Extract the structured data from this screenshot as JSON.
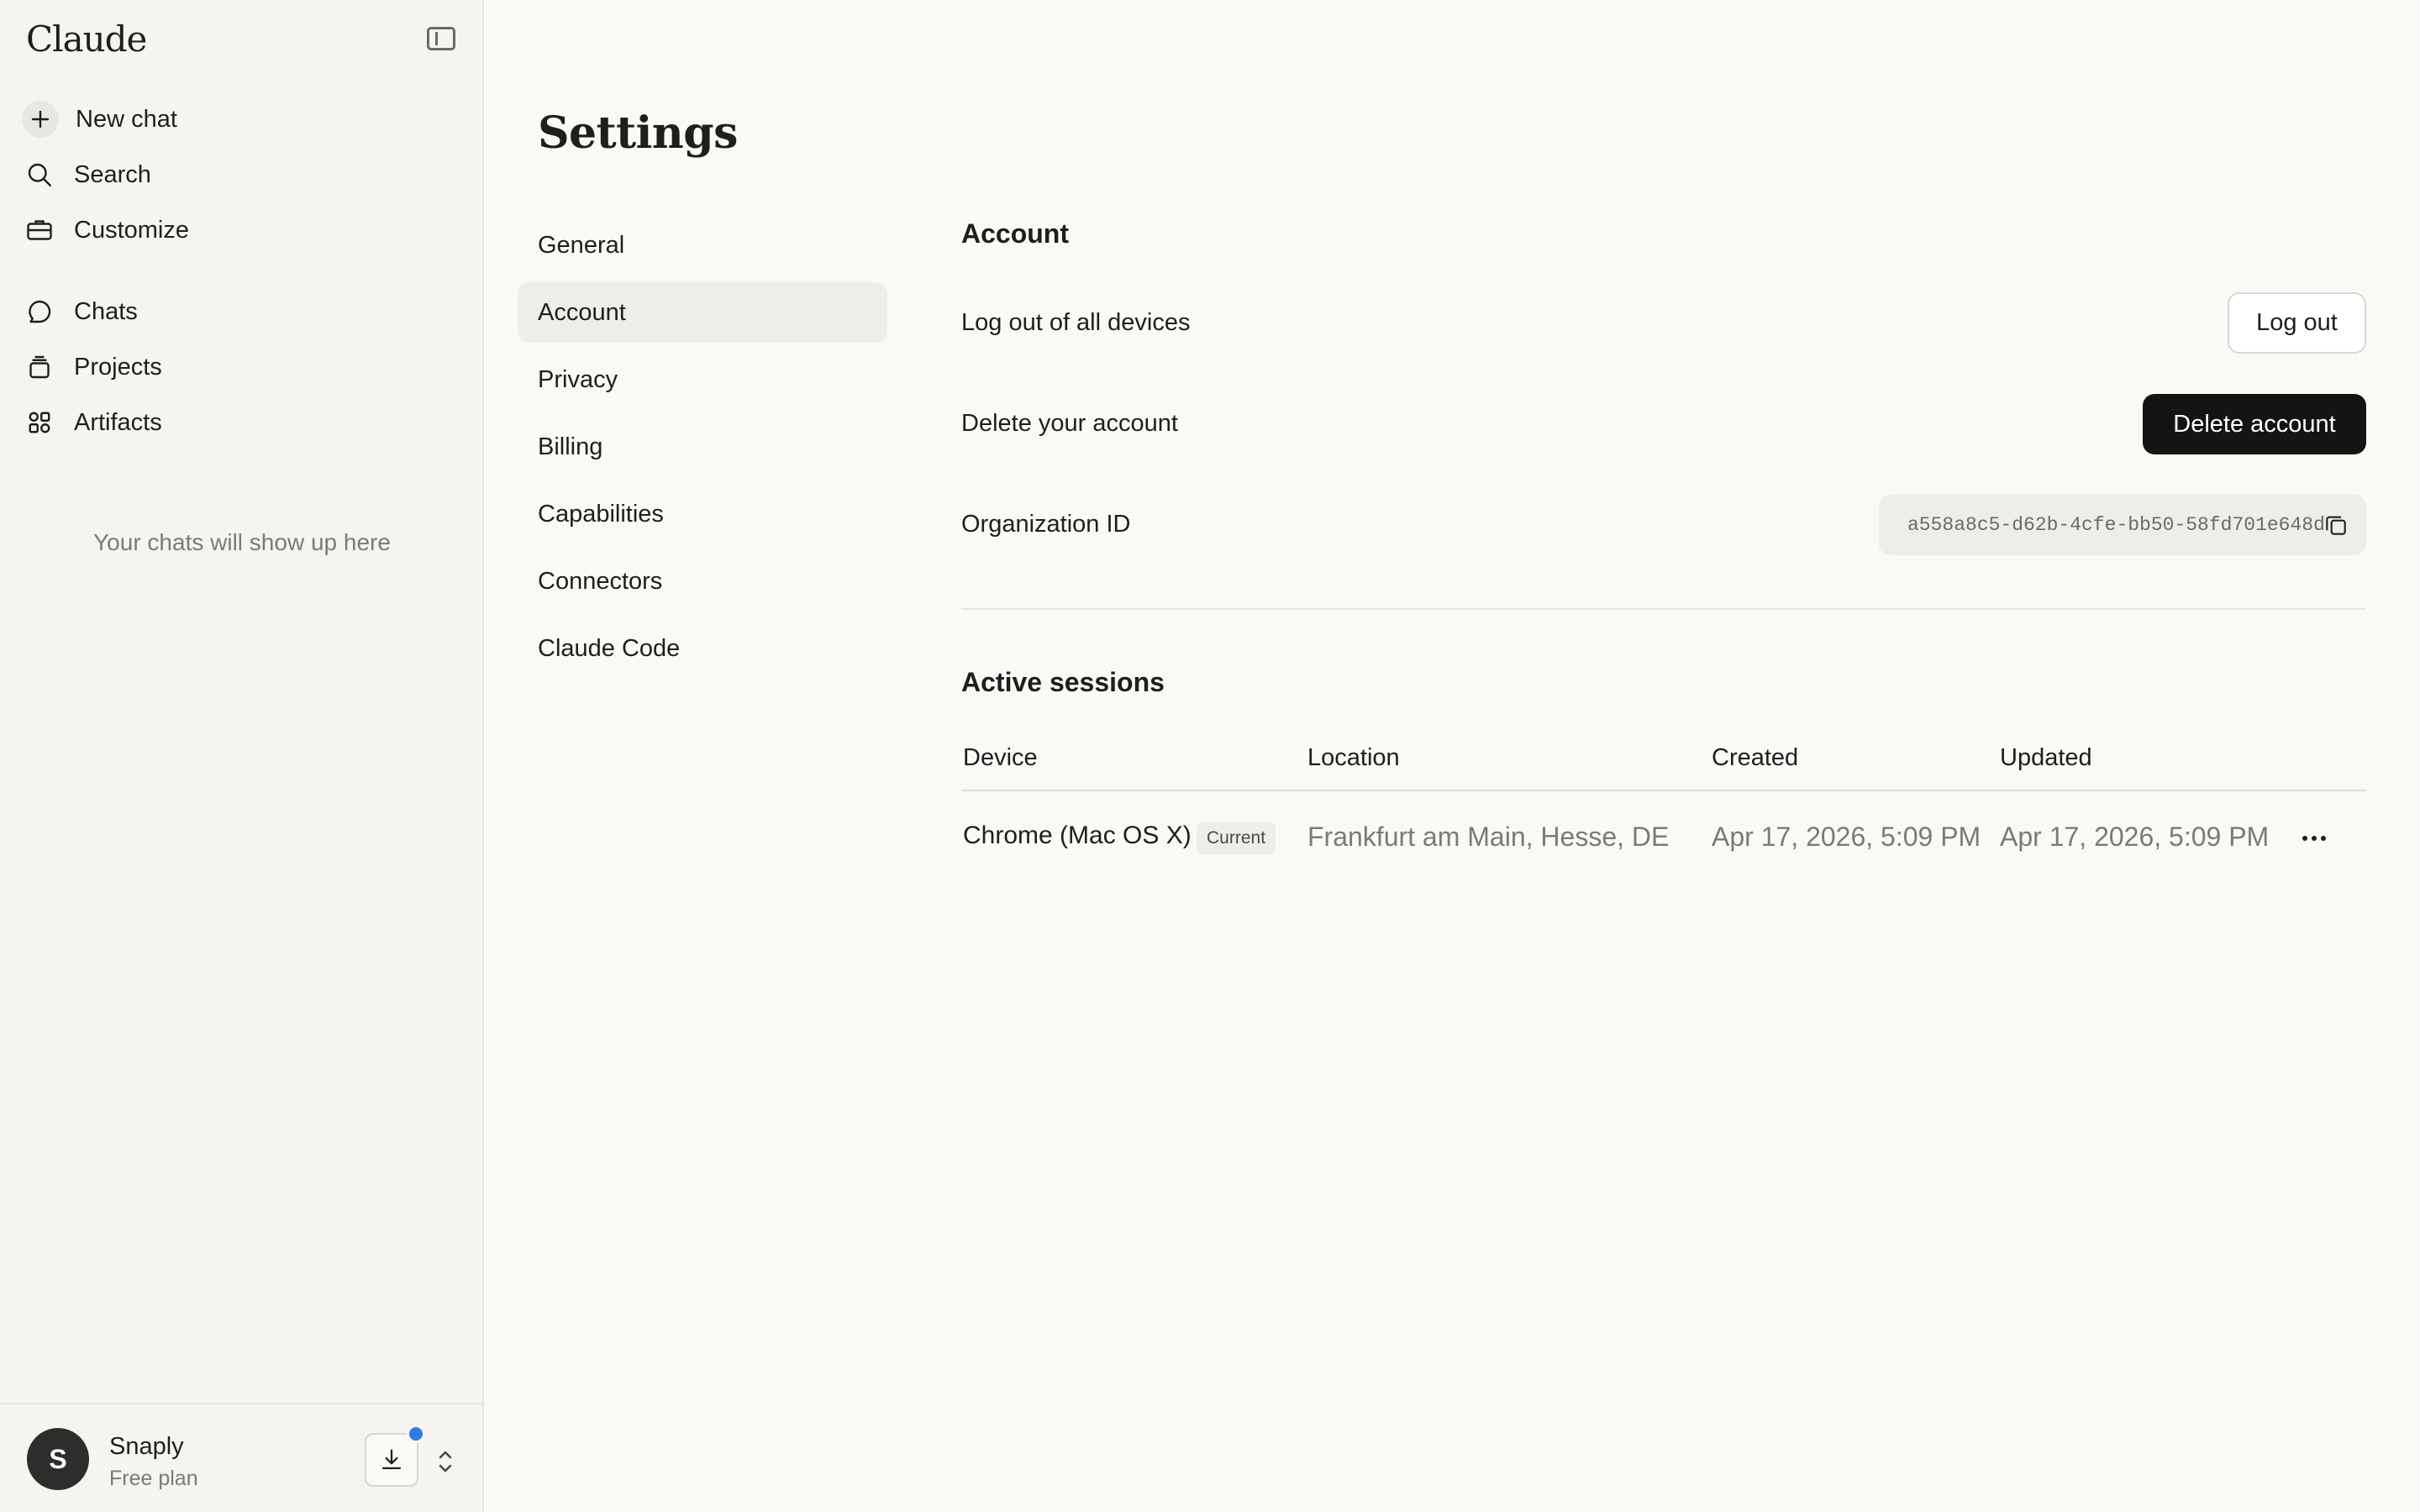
{
  "sidebar": {
    "brand": "Claude",
    "top_items": [
      {
        "label": "New chat",
        "icon": "plus-icon"
      },
      {
        "label": "Search",
        "icon": "search-icon"
      },
      {
        "label": "Customize",
        "icon": "briefcase-icon"
      }
    ],
    "nav_items": [
      {
        "label": "Chats",
        "icon": "chat-bubble-icon"
      },
      {
        "label": "Projects",
        "icon": "folder-stack-icon"
      },
      {
        "label": "Artifacts",
        "icon": "artifacts-icon"
      }
    ],
    "empty_note": "Your chats will show up here",
    "user": {
      "initial": "S",
      "name": "Snaply",
      "plan": "Free plan"
    }
  },
  "settings": {
    "title": "Settings",
    "nav": [
      {
        "label": "General",
        "active": false
      },
      {
        "label": "Account",
        "active": true
      },
      {
        "label": "Privacy",
        "active": false
      },
      {
        "label": "Billing",
        "active": false
      },
      {
        "label": "Capabilities",
        "active": false
      },
      {
        "label": "Connectors",
        "active": false
      },
      {
        "label": "Claude Code",
        "active": false
      }
    ]
  },
  "account": {
    "heading": "Account",
    "logout_label": "Log out of all devices",
    "logout_button": "Log out",
    "delete_label": "Delete your account",
    "delete_button": "Delete account",
    "org_label": "Organization ID",
    "org_id": "a558a8c5-d62b-4cfe-bb50-58fd701e648d"
  },
  "sessions": {
    "heading": "Active sessions",
    "columns": [
      "Device",
      "Location",
      "Created",
      "Updated"
    ],
    "rows": [
      {
        "device": "Chrome (Mac OS X)",
        "badge": "Current",
        "location": "Frankfurt am Main, Hesse, DE",
        "created": "Apr 17, 2026, 5:09 PM",
        "updated": "Apr 17, 2026, 5:09 PM"
      }
    ]
  },
  "colors": {
    "accent_dark": "#141413",
    "notify_dot": "#2f7ce8",
    "background": "#faf9f6",
    "sidebar_bg": "#f5f4f0"
  }
}
